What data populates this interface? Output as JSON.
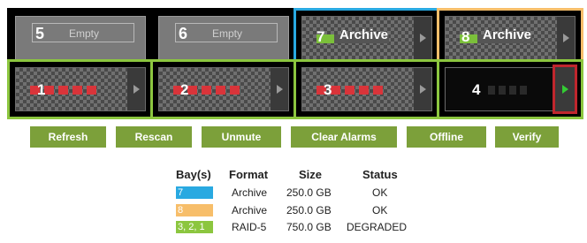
{
  "bays": [
    {
      "number": "5",
      "state": "empty",
      "label": "Empty"
    },
    {
      "number": "6",
      "state": "empty",
      "label": "Empty"
    },
    {
      "number": "7",
      "state": "archive",
      "label": "Archive",
      "border_color": "#29a9e1"
    },
    {
      "number": "8",
      "state": "archive",
      "label": "Archive",
      "border_color": "#f7be6a"
    },
    {
      "number": "1",
      "state": "raid",
      "border_color": "#8cc63f"
    },
    {
      "number": "2",
      "state": "raid",
      "border_color": "#8cc63f"
    },
    {
      "number": "3",
      "state": "raid",
      "border_color": "#8cc63f"
    },
    {
      "number": "4",
      "state": "raid-missing",
      "border_color": "#8cc63f",
      "selected": true
    }
  ],
  "buttons": [
    "Refresh",
    "Rescan",
    "Unmute",
    "Clear Alarms",
    "Offline",
    "Verify"
  ],
  "table": {
    "headers": [
      "Bay(s)",
      "Format",
      "Size",
      "Status"
    ],
    "rows": [
      {
        "bays": "7",
        "color": "#29a9e1",
        "format": "Archive",
        "size": "250.0 GB",
        "status": "OK"
      },
      {
        "bays": "8",
        "color": "#f7be6a",
        "format": "Archive",
        "size": "250.0 GB",
        "status": "OK"
      },
      {
        "bays": "3, 2, 1",
        "color": "#8cc63f",
        "format": "RAID-5",
        "size": "750.0 GB",
        "status": "DEGRADED"
      }
    ]
  },
  "colors": {
    "button_bg": "#7ca03a",
    "raid_segment": "#d9343a",
    "alert_outline": "#c0262d"
  }
}
